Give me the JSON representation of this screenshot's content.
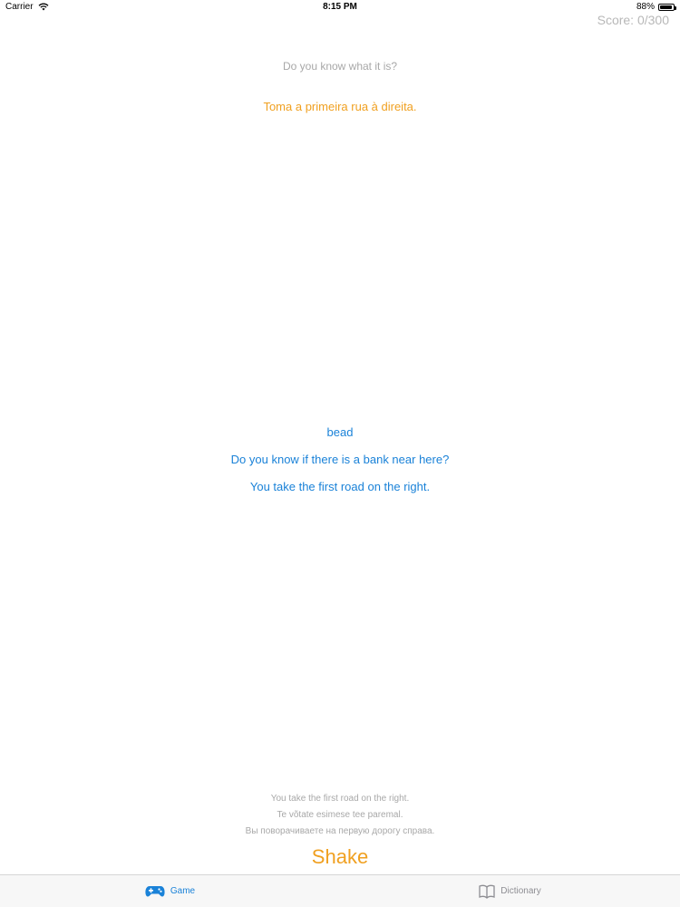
{
  "status_bar": {
    "carrier": "Carrier",
    "time": "8:15 PM",
    "battery": "88%"
  },
  "score": "Score: 0/300",
  "prompt": "Do you know what it is?",
  "question": "Toma a primeira rua à direita.",
  "options": [
    "bead",
    "Do you know if there is a bank near here?",
    "You take the first road on the right."
  ],
  "hints": [
    "You take the first road on the right.",
    "Te võtate esimese tee paremal.",
    "Вы поворачиваете на первую дорогу справа."
  ],
  "shake_label": "Shake",
  "tabs": [
    {
      "label": "Game",
      "icon": "gamepad-icon",
      "active": true
    },
    {
      "label": "Dictionary",
      "icon": "book-icon",
      "active": false
    }
  ],
  "colors": {
    "accent_orange": "#f0a020",
    "accent_blue": "#1a82d8",
    "muted_gray": "#a8a8a8"
  }
}
